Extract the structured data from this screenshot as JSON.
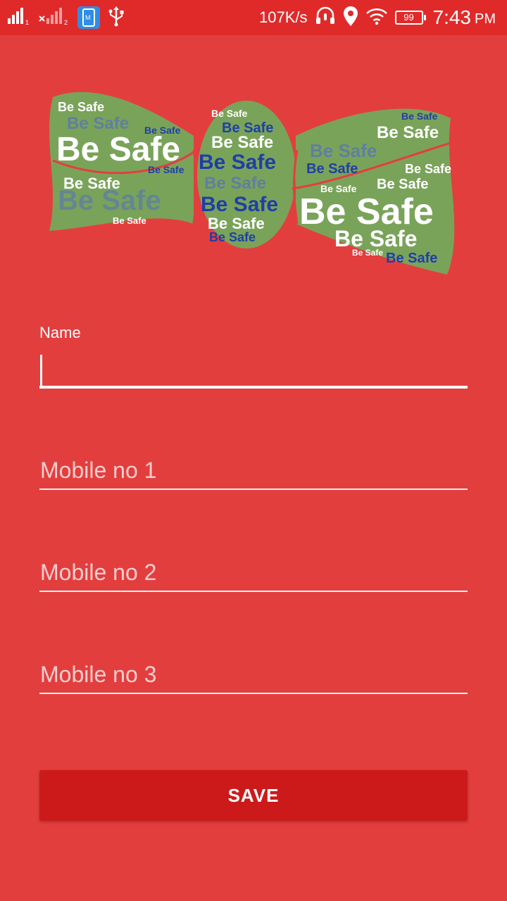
{
  "status_bar": {
    "network_speed": "107K/s",
    "battery_level": "99",
    "time": "7:43",
    "ampm": "PM",
    "sim1_label": "1",
    "sim2_label": "2",
    "icons": [
      "signal-sim1-icon",
      "signal-sim2-no-service-icon",
      "message-app-notification-icon",
      "usb-icon",
      "headset-mic-icon",
      "location-icon",
      "wifi-icon",
      "battery-icon"
    ]
  },
  "logo": {
    "word": "Be Safe",
    "colors": {
      "background": "#7aa35a",
      "white_text": "#ffffff",
      "blue_text": "#1f3fa6",
      "outline": "#e33e3e"
    }
  },
  "form": {
    "name_label": "Name",
    "name_value": "",
    "mobile1_placeholder": "Mobile no 1",
    "mobile2_placeholder": "Mobile no 2",
    "mobile3_placeholder": "Mobile no 3"
  },
  "save_button": {
    "label": "SAVE"
  },
  "colors": {
    "background": "#e33e3e",
    "status_bar": "#e02a2a",
    "button": "#cc1a1a",
    "text": "#ffffff"
  }
}
